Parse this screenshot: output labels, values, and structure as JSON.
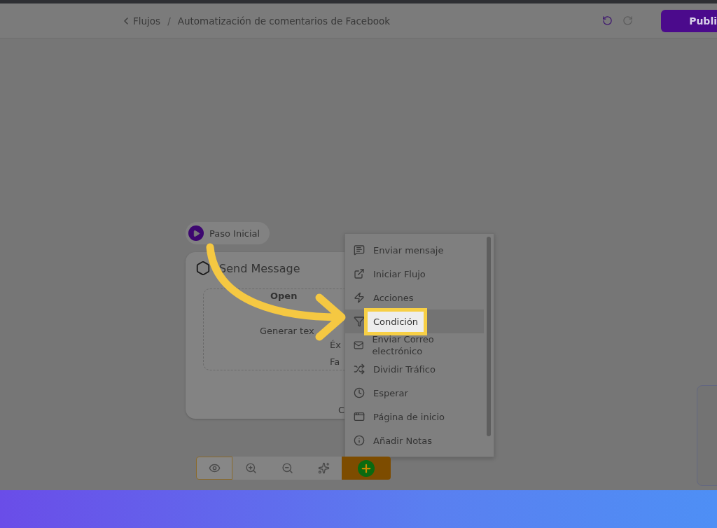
{
  "header": {
    "back_label": "Flujos",
    "separator": "/",
    "title": "Automatización de comentarios de Facebook",
    "publish_label": "Publi"
  },
  "start_chip": {
    "label": "Paso Inicial"
  },
  "node": {
    "title": "Send Message",
    "content": [
      {
        "text": "Open",
        "bold": true
      },
      {
        "text": "Generar tex",
        "bold": false
      },
      {
        "text": "Éx",
        "bold": false
      },
      {
        "text": "Fa",
        "bold": false
      }
    ],
    "footer": "C"
  },
  "menu": {
    "items": [
      {
        "kind": "message",
        "label": "Enviar mensaje",
        "selected": false
      },
      {
        "kind": "flow",
        "label": "Iniciar Flujo",
        "selected": false
      },
      {
        "kind": "action",
        "label": "Acciones",
        "selected": false
      },
      {
        "kind": "filter",
        "label": "Condición",
        "selected": true
      },
      {
        "kind": "mail",
        "label": "Enviar Correo electrónico",
        "selected": false
      },
      {
        "kind": "shuffle",
        "label": "Dividir Tráfico",
        "selected": false
      },
      {
        "kind": "clock",
        "label": "Esperar",
        "selected": false
      },
      {
        "kind": "page",
        "label": "Página de inicio",
        "selected": false
      },
      {
        "kind": "note",
        "label": "Añadir Notas",
        "selected": false
      }
    ]
  },
  "toolbar": [
    {
      "kind": "eye",
      "selected": true
    },
    {
      "kind": "zoom-in",
      "selected": false
    },
    {
      "kind": "zoom-out",
      "selected": false
    },
    {
      "kind": "sparkle",
      "selected": false
    },
    {
      "kind": "add",
      "selected": false
    }
  ]
}
